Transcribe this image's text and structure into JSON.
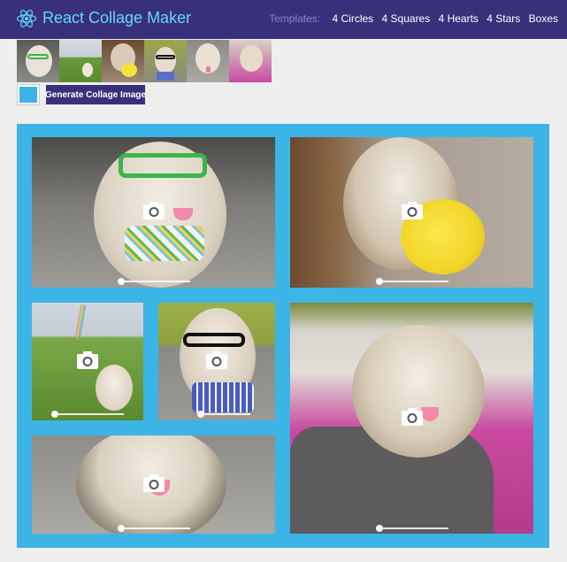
{
  "header": {
    "title": "React Collage Maker",
    "templates_label": "Templates:",
    "templates": [
      "4 Circles",
      "4 Squares",
      "4 Hearts",
      "4 Stars",
      "Boxes"
    ]
  },
  "thumbnails": [
    {
      "name": "dog-with-green-glasses"
    },
    {
      "name": "dog-on-grass"
    },
    {
      "name": "dog-with-yellow-toy"
    },
    {
      "name": "dog-with-black-glasses"
    },
    {
      "name": "dog-tongue-out"
    },
    {
      "name": "dog-on-pink-blanket"
    }
  ],
  "controls": {
    "color": "#3cb4e6",
    "generate_label": "Generate Collage Image"
  },
  "colors": {
    "header_bg": "#39307b",
    "title": "#61dafb",
    "collage_border": "#3cb4e6",
    "page_bg": "#eeeeee"
  }
}
